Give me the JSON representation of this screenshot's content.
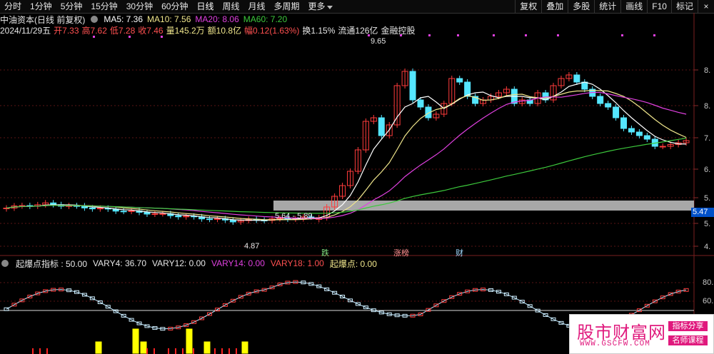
{
  "toolbar": {
    "periods": [
      "分时",
      "1分钟",
      "5分钟",
      "15分钟",
      "30分钟",
      "60分钟",
      "日线",
      "周线",
      "月线",
      "多周期",
      "更多"
    ],
    "right_buttons": [
      "复权",
      "叠加",
      "多股",
      "统计",
      "画线",
      "F10",
      "标记"
    ],
    "close_symbol": "×"
  },
  "stock": {
    "name": "中油资本(日线 前复权)",
    "ma5": "MA5: 7.36",
    "ma10": "MA10: 7.56",
    "ma20": "MA20: 8.06",
    "ma60": "MA60: 7.20",
    "date": "2024/11/29五",
    "open": "开7.33",
    "high": "高7.62",
    "low": "低7.28",
    "close": "收7.46",
    "volume": "量145.2万",
    "amount": "额10.8亿",
    "change": "幅0.12(1.63%)",
    "turnover": "换1.15%",
    "float_mkt": "流通126亿",
    "sector": "金融控股"
  },
  "annotations": {
    "high_label": "9.65",
    "low_label": "4.87",
    "band_label": "5.64 - 5.89",
    "markers": [
      "跌",
      "涨榜",
      "财"
    ]
  },
  "axis": {
    "current_price": "5.47",
    "price_ticks": [
      "8.",
      "8.",
      "7.",
      "6.",
      "5.",
      "5.",
      "4."
    ],
    "ind_ticks": [
      "80.",
      "60."
    ]
  },
  "indicator": {
    "name": "起爆点指标 : 50.00",
    "vary4": "VARY4: 36.70",
    "vary12": "VARY12: 0.00",
    "vary14": "VARY14: 0.00",
    "vary18": "VARY18: 1.00",
    "qbd": "起爆点: 0.00"
  },
  "watermark": {
    "title": "股市财富网",
    "url": "WWW.GSCFW.COM",
    "tag1": "指标分享",
    "tag2": "名师课程"
  },
  "colors": {
    "up": "#ff3b3b",
    "down": "#55e6ff",
    "ma5": "#ffffff",
    "ma10": "#f0e68c",
    "ma20": "#e040e0",
    "ma60": "#3cc83c",
    "cur_price_bg": "#0050c8"
  }
}
